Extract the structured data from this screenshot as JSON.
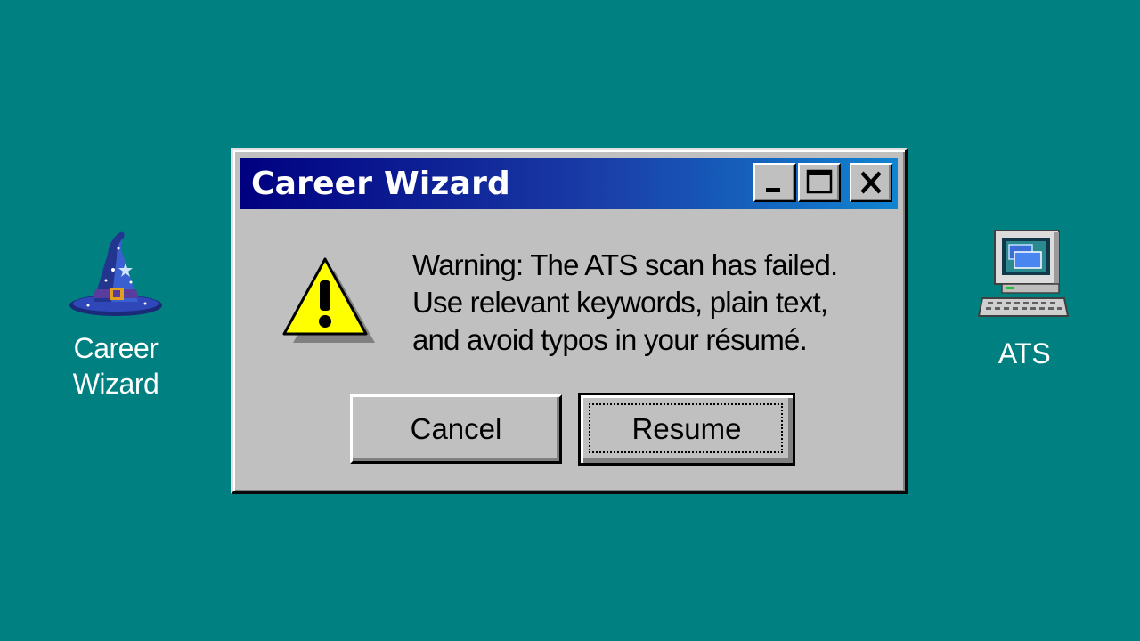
{
  "desktop": {
    "background_color": "#008080",
    "icons": [
      {
        "label": "Career\nWizard",
        "line1": "Career",
        "line2": "Wizard",
        "icon": "wizard-hat-icon"
      },
      {
        "label": "ATS",
        "icon": "computer-icon"
      }
    ]
  },
  "dialog": {
    "title": "Career Wizard",
    "title_buttons": [
      "minimize",
      "maximize",
      "close"
    ],
    "icon": "warning-icon",
    "message_lines": [
      "Warning: The ATS scan has failed.",
      "Use relevant keywords, plain text,",
      "and avoid typos in your résumé."
    ],
    "buttons": {
      "cancel_label": "Cancel",
      "resume_label": "Resume",
      "default": "Resume"
    },
    "colors": {
      "titlebar_start": "#000080",
      "titlebar_end": "#1084d0",
      "face": "#c0c0c0"
    }
  }
}
